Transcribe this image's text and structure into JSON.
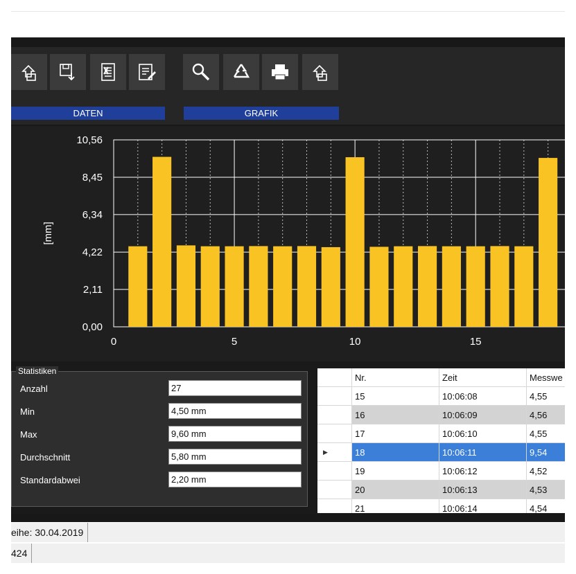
{
  "toolbar": {
    "data_buttons": [
      "open-file-icon",
      "save-file-icon",
      "export-excel-icon",
      "edit-document-icon"
    ],
    "graph_buttons": [
      "magnifier-icon",
      "recycle-icon",
      "printer-icon",
      "open-file-icon"
    ],
    "data_label": "DATEN",
    "graph_label": "GRAFIK"
  },
  "chart_data": {
    "type": "bar",
    "ylabel": "[mm]",
    "ylim": [
      0,
      10.56
    ],
    "xlim": [
      0,
      18.7
    ],
    "y_ticks": [
      "10,56",
      "8,45",
      "6,34",
      "4,22",
      "2,11",
      "0,00"
    ],
    "x_ticks": [
      "0",
      "5",
      "10",
      "15"
    ],
    "bar_color": "#f9c423",
    "x": [
      1,
      2,
      3,
      4,
      5,
      6,
      7,
      8,
      9,
      10,
      11,
      12,
      13,
      14,
      15,
      16,
      17,
      18
    ],
    "values": [
      4.55,
      9.6,
      4.6,
      4.55,
      4.55,
      4.56,
      4.55,
      4.56,
      4.5,
      9.58,
      4.52,
      4.55,
      4.56,
      4.55,
      4.55,
      4.56,
      4.55,
      9.54
    ]
  },
  "stats": {
    "title": "Statistiken",
    "items": [
      {
        "label": "Anzahl",
        "value": "27"
      },
      {
        "label": "Min",
        "value": "4,50 mm"
      },
      {
        "label": "Max",
        "value": "9,60 mm"
      },
      {
        "label": "Durchschnitt",
        "value": "5,80 mm"
      },
      {
        "label": "Standardabwei",
        "value": "2,20 mm"
      }
    ]
  },
  "table": {
    "headers": [
      "Nr.",
      "Zeit",
      "Messwe"
    ],
    "rows": [
      {
        "nr": "15",
        "zeit": "10:06:08",
        "wert": "4,55"
      },
      {
        "nr": "16",
        "zeit": "10:06:09",
        "wert": "4,56"
      },
      {
        "nr": "17",
        "zeit": "10:06:10",
        "wert": "4,55"
      },
      {
        "nr": "18",
        "zeit": "10:06:11",
        "wert": "9,54"
      },
      {
        "nr": "19",
        "zeit": "10:06:12",
        "wert": "4,52"
      },
      {
        "nr": "20",
        "zeit": "10:06:13",
        "wert": "4,53"
      },
      {
        "nr": "21",
        "zeit": "10:06:14",
        "wert": "4,54"
      }
    ],
    "selected_index": 3,
    "gray_indices": [
      1,
      5
    ]
  },
  "status": {
    "line1": "eihe: 30.04.2019",
    "line2": "424"
  }
}
